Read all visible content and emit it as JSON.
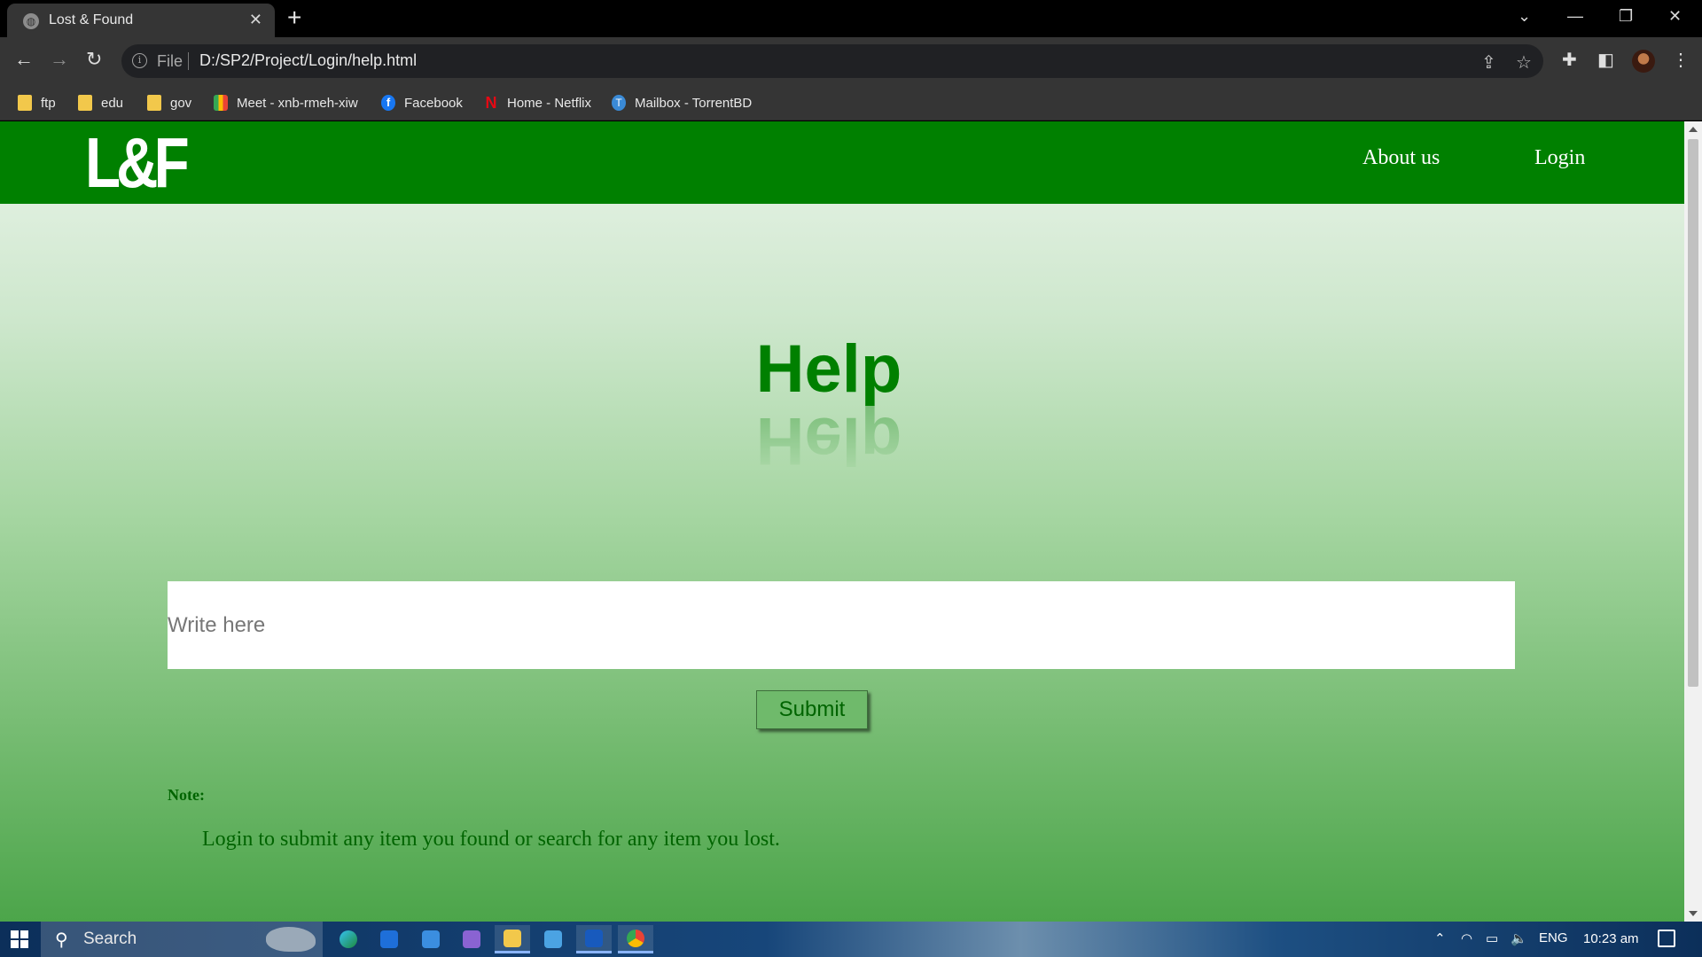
{
  "browser": {
    "tab_title": "Lost & Found",
    "new_tab_glyph": "+",
    "address_scheme": "File",
    "address_url": "D:/SP2/Project/Login/help.html",
    "bookmarks": [
      {
        "label": "ftp",
        "icon": "folder-icon"
      },
      {
        "label": "edu",
        "icon": "folder-icon"
      },
      {
        "label": "gov",
        "icon": "folder-icon"
      },
      {
        "label": "Meet - xnb-rmeh-xiw",
        "icon": "google-meet-icon"
      },
      {
        "label": "Facebook",
        "icon": "facebook-icon"
      },
      {
        "label": "Home - Netflix",
        "icon": "netflix-icon"
      },
      {
        "label": "Mailbox - TorrentBD",
        "icon": "torrentbd-icon"
      }
    ]
  },
  "site": {
    "logo": "L&F",
    "nav": {
      "about": "About us",
      "login": "Login"
    },
    "colors": {
      "header": "#008000",
      "text": "#006400"
    }
  },
  "help": {
    "title": "Help",
    "input_placeholder": "Write here",
    "submit_label": "Submit",
    "note_label": "Note:",
    "note_text": "Login to submit any item you found or search for any item you lost."
  },
  "taskbar": {
    "search_placeholder": "Search",
    "language": "ENG",
    "time": "10:23 am"
  }
}
